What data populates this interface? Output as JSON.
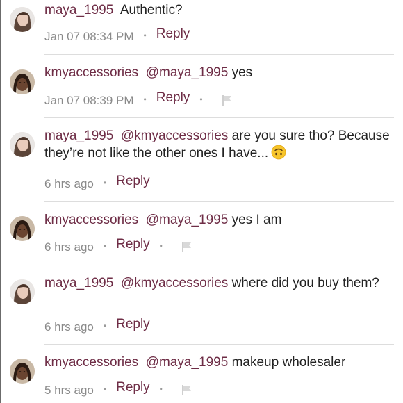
{
  "comments": [
    {
      "username": "maya_1995",
      "mention": "",
      "text": "Authentic?",
      "timestamp": "Jan 07 08:34 PM",
      "reply_label": "Reply",
      "has_flag": false,
      "avatar": "maya"
    },
    {
      "username": "kmyaccessories",
      "mention": "@maya_1995",
      "text": "yes",
      "timestamp": "Jan 07 08:39 PM",
      "reply_label": "Reply",
      "has_flag": true,
      "avatar": "kmy"
    },
    {
      "username": "maya_1995",
      "mention": "@kmyaccessories",
      "text": "are you sure tho? Because they’re not like the other ones I have...",
      "emoji": "upside-down-face",
      "timestamp": "6 hrs ago",
      "reply_label": "Reply",
      "has_flag": false,
      "avatar": "maya"
    },
    {
      "username": "kmyaccessories",
      "mention": "@maya_1995",
      "text": "yes I am",
      "timestamp": "6 hrs ago",
      "reply_label": "Reply",
      "has_flag": true,
      "avatar": "kmy"
    },
    {
      "username": "maya_1995",
      "mention": "@kmyaccessories",
      "text": "where did you buy them?",
      "timestamp": "6 hrs ago",
      "reply_label": "Reply",
      "has_flag": false,
      "avatar": "maya"
    },
    {
      "username": "kmyaccessories",
      "mention": "@maya_1995",
      "text": "makeup wholesaler",
      "timestamp": "5 hrs ago",
      "reply_label": "Reply",
      "has_flag": true,
      "avatar": "kmy"
    }
  ],
  "colors": {
    "username": "#6e2d46",
    "body_text": "#222222",
    "meta_text": "#8a8a8a",
    "divider": "#dddddd"
  },
  "icons": {
    "flag": "flag-icon",
    "separator": "dot-separator",
    "emoji": "upside-down-face-emoji"
  }
}
